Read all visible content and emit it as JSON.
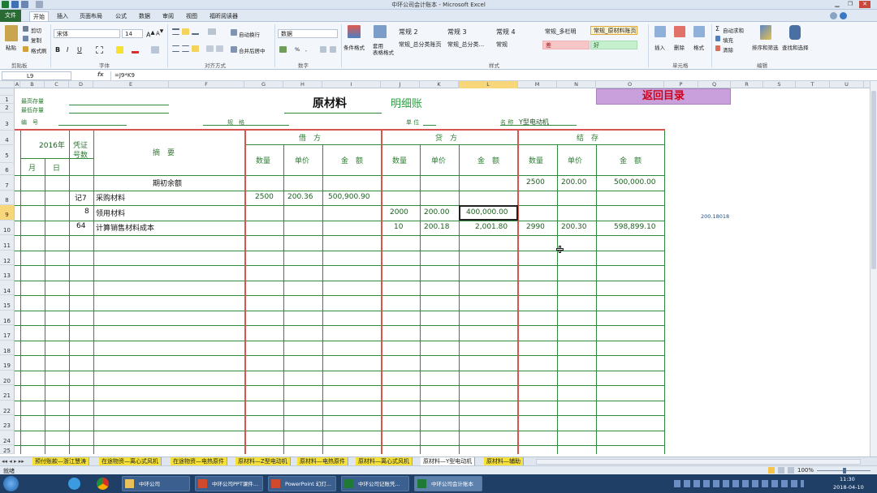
{
  "window": {
    "title": "中环公司会计账本 - Microsoft Excel",
    "min": "▁",
    "max": "❐",
    "close": "✕"
  },
  "tabs": [
    "文件",
    "开始",
    "插入",
    "页面布局",
    "公式",
    "数据",
    "审阅",
    "视图",
    "福昕阅读器"
  ],
  "ribbon": {
    "paste": "粘贴",
    "cut": "剪切",
    "copy": "复制",
    "format_painter": "格式刷",
    "font_name": "宋体",
    "font_size": "14",
    "bold": "B",
    "italic": "I",
    "underline": "U",
    "wrap": "自动换行",
    "merge": "合并后居中",
    "num_format": "数据",
    "cond_format": "条件格式",
    "table_format": "套用\n表格格式",
    "styles": [
      "常规 2",
      "常规 3",
      "常规 4",
      "常规_多栏明",
      "常规_原材料账页",
      "常规_总分类账页",
      "常规_总分类...",
      "常规",
      "差",
      "好"
    ],
    "insert": "插入",
    "delete": "删除",
    "format": "格式",
    "autosum": "自动求和",
    "fill": "填充",
    "clear": "清除",
    "sort": "排序和筛选",
    "find": "查找和选择",
    "groups": [
      "剪贴板",
      "字体",
      "对齐方式",
      "数字",
      "样式",
      "单元格",
      "编辑"
    ]
  },
  "formula": {
    "namebox": "L9",
    "fx": "fx",
    "content": "=J9*K9"
  },
  "columns": [
    "A",
    "B",
    "C",
    "D",
    "E",
    "F",
    "G",
    "H",
    "I",
    "J",
    "K",
    "L",
    "M",
    "N",
    "O",
    "P",
    "Q",
    "R",
    "S",
    "T",
    "U"
  ],
  "rows": [
    "1",
    "2",
    "3",
    "4",
    "5",
    "6",
    "7",
    "8",
    "9",
    "10",
    "11",
    "12",
    "13",
    "14",
    "15",
    "16",
    "17",
    "18",
    "19",
    "20",
    "21",
    "22",
    "23",
    "24",
    "25"
  ],
  "sheet": {
    "max_stock": "最高存量",
    "min_stock": "最低存量",
    "code": "编　号",
    "title_main": "原材料",
    "title_sub": "明细账",
    "spec": "规　格",
    "unit": "单 位",
    "name_label": "名 称",
    "name_value": "Y型电动机",
    "back": "返回目录",
    "year": "2016年",
    "voucher": "凭证\n号数",
    "month": "月",
    "day": "日",
    "summary": "摘　要",
    "debit": "借　方",
    "credit": "贷　方",
    "balance": "结　存",
    "qty": "数量",
    "price": "单价",
    "amount": "金　额",
    "side_value": "200.18018",
    "rows": [
      {
        "voucher": "",
        "summary": "期初余额",
        "dq": "",
        "dp": "",
        "da": "",
        "cq": "",
        "cp": "",
        "ca": "",
        "bq": "2500",
        "bp": "200.00",
        "ba": "500,000.00"
      },
      {
        "voucher": "记7",
        "summary": "采购材料",
        "dq": "2500",
        "dp": "200.36",
        "da": "500,900.90",
        "cq": "",
        "cp": "",
        "ca": "",
        "bq": "",
        "bp": "",
        "ba": ""
      },
      {
        "voucher": "8",
        "summary": "领用材料",
        "dq": "",
        "dp": "",
        "da": "",
        "cq": "2000",
        "cp": "200.00",
        "ca": "400,000.00",
        "bq": "",
        "bp": "",
        "ba": ""
      },
      {
        "voucher": "64",
        "summary": "计算销售材料成本",
        "dq": "",
        "dp": "",
        "da": "",
        "cq": "10",
        "cp": "200.18",
        "ca": "2,001.80",
        "bq": "2990",
        "bp": "200.30",
        "ba": "598,899.10"
      }
    ]
  },
  "sheet_tabs": [
    "预付账款—浙江慧涛",
    "在途物资—离心式风机",
    "在途物资—电热原件",
    "原材料—Z型电动机",
    "原材料—电热原件",
    "原材料—离心式风机",
    "原材料—Y型电动机",
    "原材料—辅助"
  ],
  "status": {
    "ready": "就绪",
    "zoom": "100%"
  },
  "taskbar": {
    "items": [
      "中环公司",
      "中环公司PPT课件...",
      "PowerPoint 幻灯...",
      "中环公司记账凭...",
      "中环公司会计账本"
    ],
    "time": "11:30",
    "date": "2018-04-10"
  }
}
